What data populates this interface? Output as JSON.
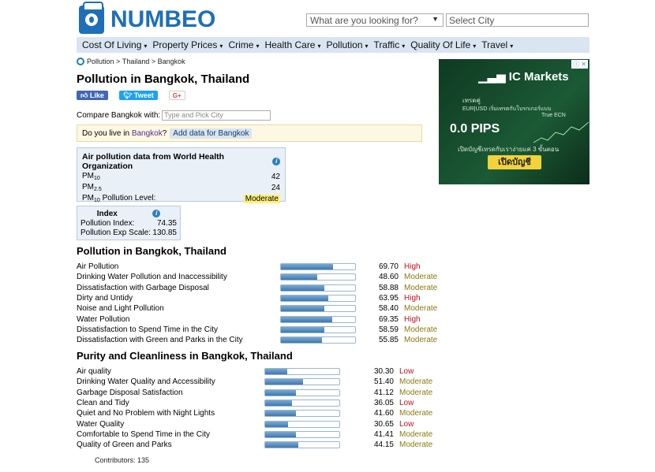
{
  "header": {
    "logo_text": "NUMBEO",
    "search_placeholder": "What are you looking for?",
    "city_placeholder": "Select City"
  },
  "nav": [
    {
      "label": "Cost Of Living"
    },
    {
      "label": "Property Prices"
    },
    {
      "label": "Crime"
    },
    {
      "label": "Health Care"
    },
    {
      "label": "Pollution"
    },
    {
      "label": "Traffic"
    },
    {
      "label": "Quality Of Life"
    },
    {
      "label": "Travel"
    }
  ],
  "breadcrumb": {
    "pollution": "Pollution",
    "sep1": ">",
    "country": "Thailand",
    "sep2": ">",
    "city": "Bangkok"
  },
  "title": "Pollution in Bangkok, Thailand",
  "social": {
    "like": "Like",
    "tweet": "Tweet",
    "gplus": "G+"
  },
  "compare": {
    "label": "Compare Bangkok with:",
    "placeholder": "Type and Pick City"
  },
  "live": {
    "prefix": "Do you live in",
    "city": "Bangkok",
    "suffix": "?",
    "add_button": "Add data for Bangkok"
  },
  "who": {
    "title": "Air pollution data from World Health Organization",
    "pm10_label": "PM",
    "pm10_sub": "10",
    "pm10_value": "42",
    "pm25_label": "PM",
    "pm25_sub": "2.5",
    "pm25_value": "24",
    "level_label_pre": "PM",
    "level_label_sub": "10",
    "level_label_post": "Pollution Level:",
    "level_value": "Moderate"
  },
  "index": {
    "title": "Index",
    "pollution_index_label": "Pollution Index:",
    "pollution_index_value": "74.35",
    "exp_scale_label": "Pollution Exp Scale:",
    "exp_scale_value": "130.85"
  },
  "pollution_section": {
    "title": "Pollution in Bangkok, Thailand",
    "rows": [
      {
        "label": "Air Pollution",
        "value": "69.70",
        "level": "High",
        "pct": 69.7
      },
      {
        "label": "Drinking Water Pollution and Inaccessibility",
        "value": "48.60",
        "level": "Moderate",
        "pct": 48.6
      },
      {
        "label": "Dissatisfaction with Garbage Disposal",
        "value": "58.88",
        "level": "Moderate",
        "pct": 58.88
      },
      {
        "label": "Dirty and Untidy",
        "value": "63.95",
        "level": "High",
        "pct": 63.95
      },
      {
        "label": "Noise and Light Pollution",
        "value": "58.40",
        "level": "Moderate",
        "pct": 58.4
      },
      {
        "label": "Water Pollution",
        "value": "69.35",
        "level": "High",
        "pct": 69.35
      },
      {
        "label": "Dissatisfaction to Spend Time in the City",
        "value": "58.59",
        "level": "Moderate",
        "pct": 58.59
      },
      {
        "label": "Dissatisfaction with Green and Parks in the City",
        "value": "55.85",
        "level": "Moderate",
        "pct": 55.85
      }
    ]
  },
  "purity_section": {
    "title": "Purity and Cleanliness in Bangkok, Thailand",
    "rows": [
      {
        "label": "Air quality",
        "value": "30.30",
        "level": "Low",
        "pct": 30.3
      },
      {
        "label": "Drinking Water Quality and Accessibility",
        "value": "51.40",
        "level": "Moderate",
        "pct": 51.4
      },
      {
        "label": "Garbage Disposal Satisfaction",
        "value": "41.12",
        "level": "Moderate",
        "pct": 41.12
      },
      {
        "label": "Clean and Tidy",
        "value": "36.05",
        "level": "Low",
        "pct": 36.05
      },
      {
        "label": "Quiet and No Problem with Night Lights",
        "value": "41.60",
        "level": "Moderate",
        "pct": 41.6
      },
      {
        "label": "Water Quality",
        "value": "30.65",
        "level": "Low",
        "pct": 30.65
      },
      {
        "label": "Comfortable to Spend Time in the City",
        "value": "41.41",
        "level": "Moderate",
        "pct": 41.41
      },
      {
        "label": "Quality of Green and Parks",
        "value": "44.15",
        "level": "Moderate",
        "pct": 44.15
      }
    ]
  },
  "contributors": "Contributors: 135",
  "ad": {
    "close": "ⓘ ✕",
    "logo": "IC Markets",
    "line1": "เทรดคู่",
    "line2": "EUR|USD   เริ่มเทรดกับโบรกเกอร์แบบ",
    "line3": "True ECN",
    "pips": "0.0 PIPS",
    "line4": "เปิดบัญชีเทรดกับเราง่ายแค่ 3 ขั้นตอน",
    "cta": "เปิดบัญชี"
  },
  "colors": {
    "brand": "#1e6fb6",
    "nav_bg": "#d9e5f1",
    "high": "#c0101a",
    "moderate": "#8a7a10",
    "low": "#c0101a"
  }
}
